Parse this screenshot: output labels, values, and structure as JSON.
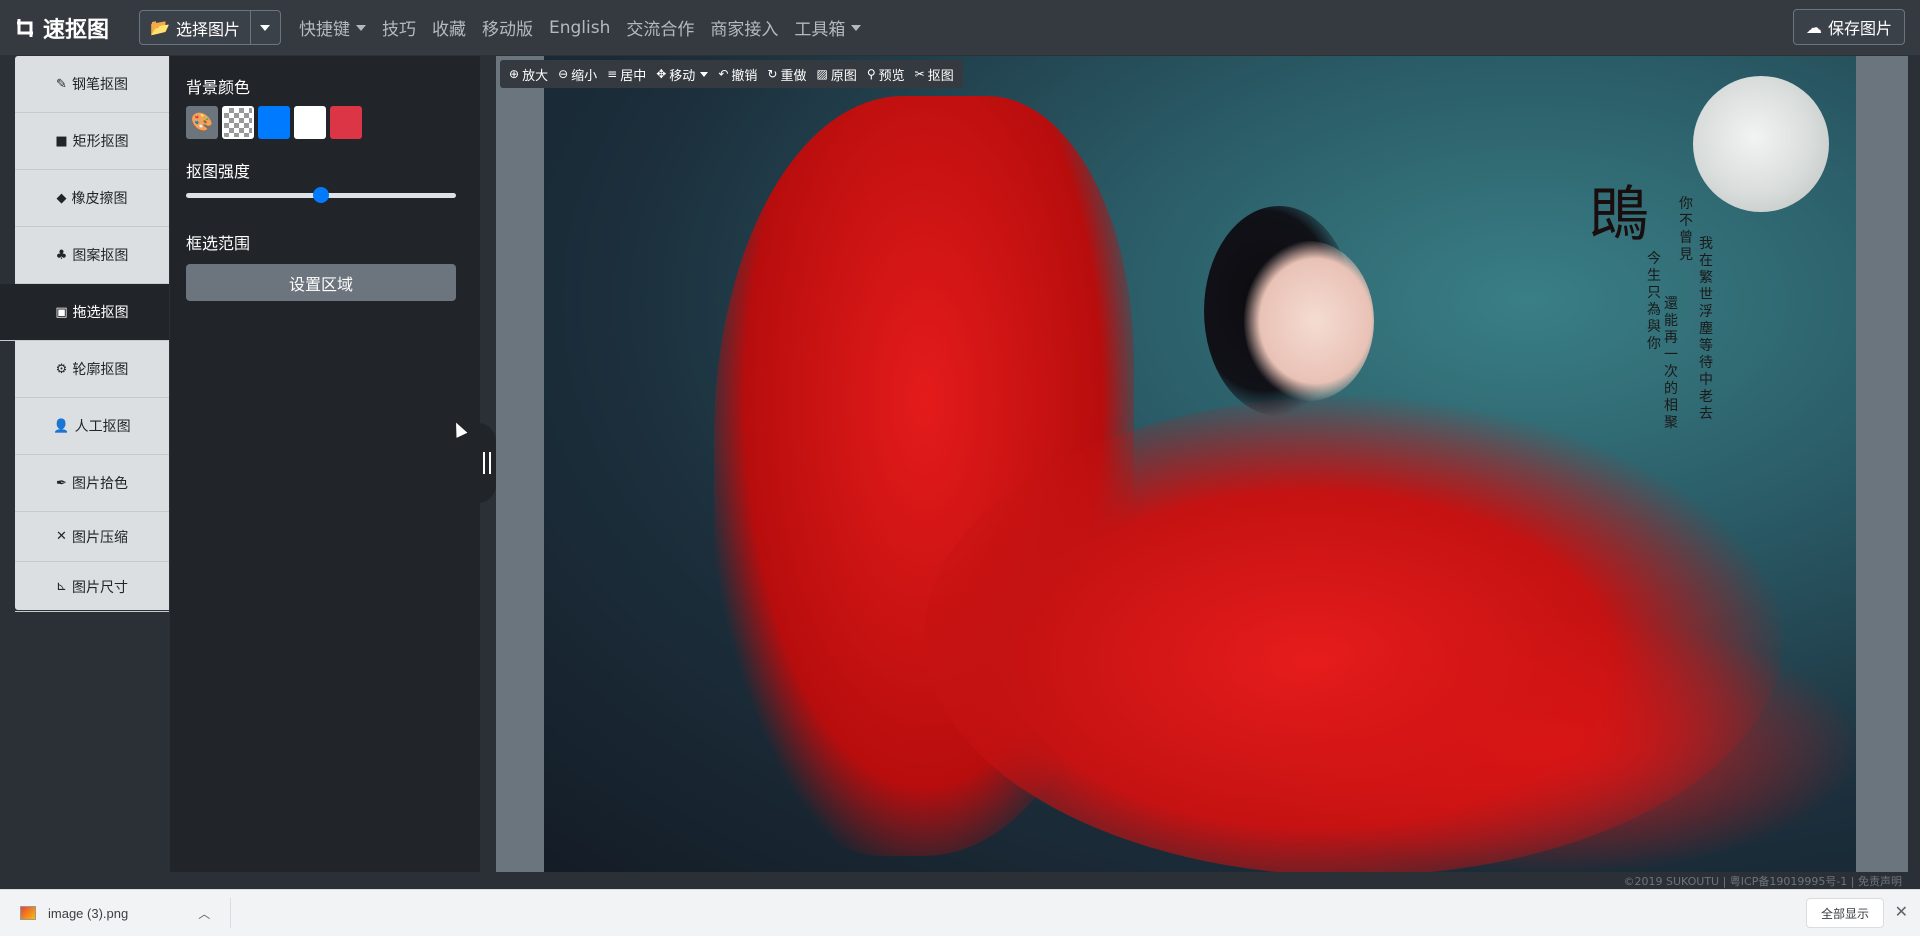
{
  "app": {
    "brand": "速抠图",
    "select_image": "选择图片",
    "save_image": "保存图片"
  },
  "nav": [
    {
      "label": "快捷键",
      "dropdown": true
    },
    {
      "label": "技巧"
    },
    {
      "label": "收藏"
    },
    {
      "label": "移动版"
    },
    {
      "label": "English"
    },
    {
      "label": "交流合作"
    },
    {
      "label": "商家接入"
    },
    {
      "label": "工具箱",
      "dropdown": true
    }
  ],
  "tools": [
    {
      "label": "钢笔抠图",
      "icon": "pen-icon"
    },
    {
      "label": "矩形抠图",
      "icon": "square-icon"
    },
    {
      "label": "橡皮擦图",
      "icon": "eraser-icon"
    },
    {
      "label": "图案抠图",
      "icon": "shapes-icon"
    },
    {
      "label": "拖选抠图",
      "icon": "chalkboard-icon",
      "active": true
    },
    {
      "label": "轮廓抠图",
      "icon": "robot-icon"
    },
    {
      "label": "人工抠图",
      "icon": "user-icon"
    },
    {
      "label": "图片拾色",
      "icon": "eyedropper-icon"
    },
    {
      "label": "图片压缩",
      "icon": "compress-icon"
    },
    {
      "label": "图片尺寸",
      "icon": "ruler-icon"
    }
  ],
  "panel": {
    "bg_color_label": "背景颜色",
    "swatches": [
      "palette",
      "transparent",
      "#007bff",
      "#ffffff",
      "#dc3545"
    ],
    "strength_label": "抠图强度",
    "strength_value": 0.5,
    "range_label": "框选范围",
    "set_area_button": "设置区域"
  },
  "canvas_tools": [
    {
      "label": "放大",
      "icon": "zoom-in-icon"
    },
    {
      "label": "缩小",
      "icon": "zoom-out-icon"
    },
    {
      "label": "居中",
      "icon": "align-center-icon"
    },
    {
      "label": "移动",
      "icon": "move-icon",
      "dropdown": true
    },
    {
      "label": "撤销",
      "icon": "undo-icon"
    },
    {
      "label": "重做",
      "icon": "redo-icon"
    },
    {
      "label": "原图",
      "icon": "image-icon"
    },
    {
      "label": "预览",
      "icon": "search-icon"
    },
    {
      "label": "抠图",
      "icon": "cut-icon"
    }
  ],
  "photo": {
    "title_char": "鵖",
    "poem_cols": [
      "你不曾見",
      "我在繁世浮塵等待中老去",
      "今生只為與你",
      "還能再一次的相聚"
    ]
  },
  "footer": "©2019 SUKOUTU | 粤ICP备19019995号-1 | 免责声明",
  "download": {
    "file_name": "image (3).png",
    "show_all": "全部显示"
  }
}
